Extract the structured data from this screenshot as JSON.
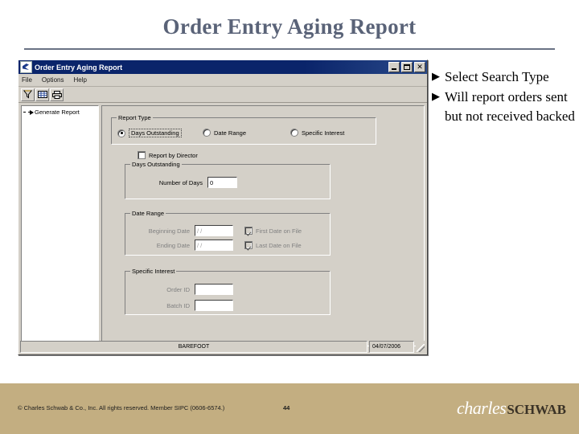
{
  "slide": {
    "title": "Order Entry Aging Report",
    "bullets": [
      "Select Search Type",
      "Will report orders sent but not received backed"
    ],
    "bullet_marker": "▶"
  },
  "app_window": {
    "titlebar": {
      "title": "Order Entry Aging Report",
      "icon": "app-window-icon",
      "minimize_label": "",
      "maximize_label": "",
      "close_label": "✕"
    },
    "menu": [
      {
        "label": "File",
        "accel": "F"
      },
      {
        "label": "Options",
        "accel": "O"
      },
      {
        "label": "Help",
        "accel": "H"
      }
    ],
    "toolbar": [
      {
        "name": "filter-icon",
        "tip": "Filter"
      },
      {
        "name": "grid-icon",
        "tip": "Grid"
      },
      {
        "name": "print-icon",
        "tip": "Print"
      }
    ],
    "tree": {
      "items": [
        {
          "label": "Generate Report"
        }
      ]
    },
    "form": {
      "report_type": {
        "legend": "Report Type",
        "options": [
          {
            "label": "Days Outstanding",
            "checked": true
          },
          {
            "label": "Date Range",
            "checked": false
          },
          {
            "label": "Specific Interest",
            "checked": false
          }
        ]
      },
      "report_by_director": {
        "label": "Report by Director",
        "checked": false
      },
      "days_outstanding": {
        "legend": "Days Outstanding",
        "number_of_days_label": "Number of Days",
        "number_of_days_value": "0"
      },
      "date_range": {
        "legend": "Date Range",
        "beginning_date_label": "Beginning Date",
        "beginning_date_value": "/  /",
        "ending_date_label": "Ending Date",
        "ending_date_value": "/  /",
        "first_date_on_file_label": "First Date on File",
        "first_date_on_file_checked": true,
        "last_date_on_file_label": "Last Date on File",
        "last_date_on_file_checked": true
      },
      "specific_interest": {
        "legend": "Specific Interest",
        "order_id_label": "Order ID",
        "order_id_value": "",
        "batch_id_label": "Batch ID",
        "batch_id_value": ""
      }
    },
    "statusbar": {
      "user": "BAREFOOT",
      "date": "04/07/2006"
    }
  },
  "footer": {
    "copyright": "© Charles Schwab & Co., Inc.  All rights reserved.  Member SIPC  (0606-6574.)",
    "page_number": "44",
    "logo_first": "charles",
    "logo_second": "SCHWAB"
  },
  "colors": {
    "title_blue": "#5a6378",
    "titlebar_navy": "#0a246a",
    "window_face": "#d4d0c8",
    "footer_tan": "#c3ae81"
  }
}
